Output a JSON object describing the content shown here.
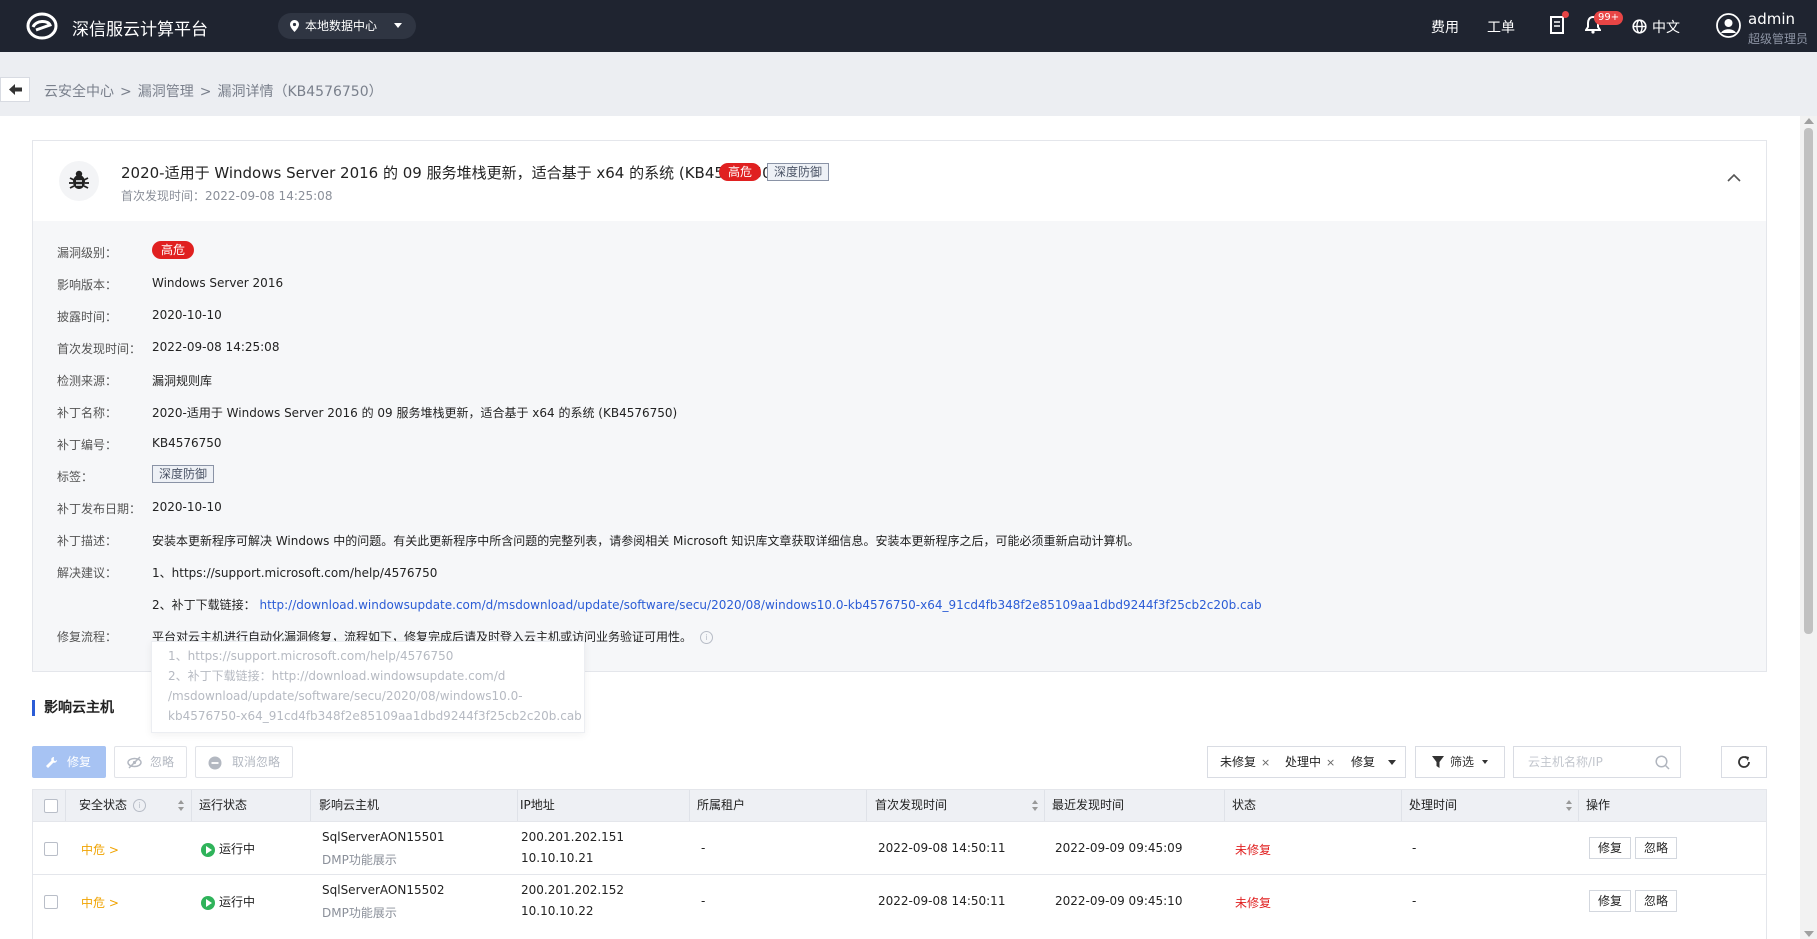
{
  "header": {
    "brand": "深信服云计算平台",
    "datacenter": "本地数据中心",
    "links": {
      "fees": "费用",
      "tickets": "工单"
    },
    "notifications_badge": "99+",
    "language": "中文",
    "user": {
      "name": "admin",
      "role": "超级管理员"
    }
  },
  "breadcrumb": {
    "items": [
      "云安全中心",
      "漏洞管理",
      "漏洞详情（KB4576750）"
    ],
    "separator": ">"
  },
  "vuln": {
    "title": "2020-适用于 Windows Server 2016 的 09 服务堆栈更新，适合基于 x64 的系统 (KB4576750)",
    "level_badge": "高危",
    "tag": "深度防御",
    "first_found": "首次发现时间：2022-09-08 14:25:08",
    "details": [
      {
        "label": "漏洞级别：",
        "value": "高危",
        "kind": "badge"
      },
      {
        "label": "影响版本：",
        "value": "Windows Server 2016"
      },
      {
        "label": "披露时间：",
        "value": "2020-10-10"
      },
      {
        "label": "首次发现时间：",
        "value": "2022-09-08 14:25:08"
      },
      {
        "label": "检测来源：",
        "value": "漏洞规则库"
      },
      {
        "label": "补丁名称：",
        "value": "2020-适用于 Windows Server 2016 的 09 服务堆栈更新，适合基于 x64 的系统 (KB4576750)"
      },
      {
        "label": "补丁编号：",
        "value": "KB4576750"
      },
      {
        "label": "标签：",
        "value": "深度防御",
        "kind": "tag"
      },
      {
        "label": "补丁发布日期：",
        "value": "2020-10-10"
      },
      {
        "label": "补丁描述：",
        "value": "安装本更新程序可解决 Windows 中的问题。有关此更新程序中所含问题的完整列表，请参阅相关 Microsoft 知识库文章获取详细信息。安装本更新程序之后，可能必须重新启动计算机。"
      },
      {
        "label": "解决建议：",
        "value": "1、https://support.microsoft.com/help/4576750"
      },
      {
        "label": "",
        "value": "2、补丁下载链接：",
        "link": "http://download.windowsupdate.com/d/msdownload/update/software/secu/2020/08/windows10.0-kb4576750-x64_91cd4fb348f2e85109aa1dbd9244f3f25cb2c20b.cab"
      },
      {
        "label": "修复流程：",
        "value": "平台对云主机进行自动化漏洞修复，流程如下，修复完成后请及时登入云主机或访问业务验证可用性。"
      }
    ],
    "tooltip_lines": [
      "1、https://support.microsoft.com/help/4576750",
      "2、补丁下载链接：http://download.windowsupdate.com/d",
      "/msdownload/update/software/secu/2020/08/windows10.0-",
      "kb4576750-x64_91cd4fb348f2e85109aa1dbd9244f3f25cb2c20b.cab"
    ]
  },
  "hosts_section": {
    "title": "影响云主机",
    "buttons": {
      "repair": "修复",
      "ignore": "忽略",
      "unignore": "取消忽略"
    },
    "status_chips": [
      "未修复",
      "处理中",
      "修复"
    ],
    "filter_label": "筛选",
    "search_placeholder": "云主机名称/IP",
    "columns": [
      "安全状态",
      "运行状态",
      "影响云主机",
      "IP地址",
      "所属租户",
      "首次发现时间",
      "最近发现时间",
      "状态",
      "处理时间",
      "操作"
    ],
    "rows": [
      {
        "risk": "中危 >",
        "run": "运行中",
        "host": "SqlServerAON15501",
        "host_sub": "DMP功能展示",
        "ip1": "200.201.202.151",
        "ip2": "10.10.10.21",
        "tenant": "-",
        "first": "2022-09-08 14:50:11",
        "last": "2022-09-09 09:45:09",
        "status": "未修复",
        "handled": "-",
        "op_repair": "修复",
        "op_ignore": "忽略"
      },
      {
        "risk": "中危 >",
        "run": "运行中",
        "host": "SqlServerAON15502",
        "host_sub": "DMP功能展示",
        "ip1": "200.201.202.152",
        "ip2": "10.10.10.22",
        "tenant": "-",
        "first": "2022-09-08 14:50:11",
        "last": "2022-09-09 09:45:10",
        "status": "未修复",
        "handled": "-",
        "op_repair": "修复",
        "op_ignore": "忽略"
      }
    ]
  },
  "colors": {
    "topbar": "#1f2430",
    "danger": "#e02020",
    "warning": "#f0a300",
    "link": "#2b5cd6",
    "running": "#2fb35a"
  }
}
